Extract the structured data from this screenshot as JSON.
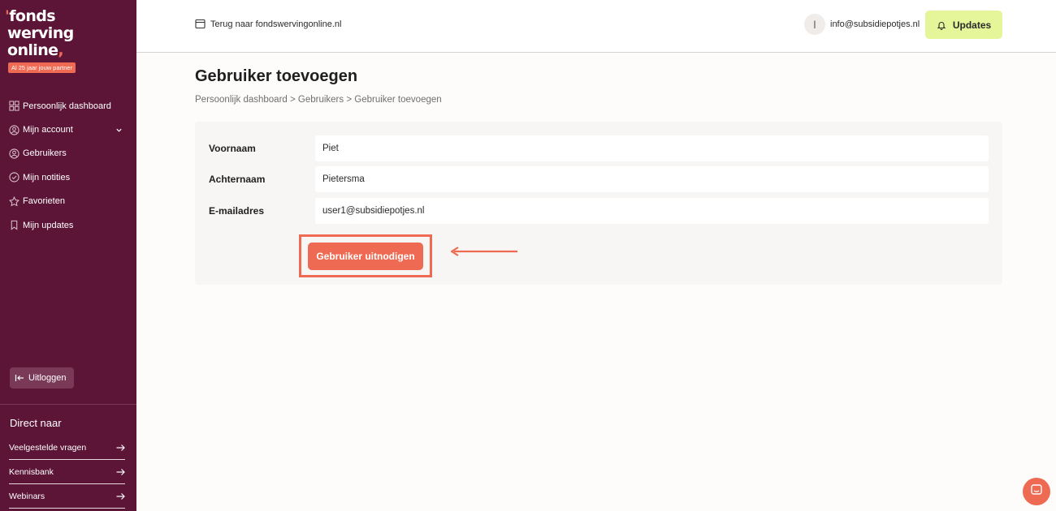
{
  "logo": {
    "line1": "fonds",
    "line2": "werving",
    "line3": "online",
    "badge": "Al 25 jaar jouw partner"
  },
  "sidebar": {
    "items": [
      {
        "label": "Persoonlijk dashboard",
        "icon": "dashboard-icon"
      },
      {
        "label": "Mijn account",
        "icon": "user-circle-icon",
        "has_dropdown": true
      },
      {
        "label": "Gebruikers",
        "icon": "users-icon"
      },
      {
        "label": "Mijn notities",
        "icon": "check-circle-icon"
      },
      {
        "label": "Favorieten",
        "icon": "star-icon"
      },
      {
        "label": "Mijn updates",
        "icon": "bookmark-icon"
      }
    ],
    "logout_label": "Uitloggen",
    "direct_title": "Direct naar",
    "direct_links": [
      {
        "label": "Veelgestelde vragen"
      },
      {
        "label": "Kennisbank"
      },
      {
        "label": "Webinars"
      }
    ]
  },
  "header": {
    "back_label": "Terug naar fondswervingonline.nl",
    "user_initial": "I",
    "user_email": "info@subsidiepotjes.nl",
    "updates_label": "Updates"
  },
  "main": {
    "title": "Gebruiker toevoegen",
    "breadcrumb": "Persoonlijk dashboard > Gebruikers > Gebruiker toevoegen",
    "form": {
      "fields": [
        {
          "label": "Voornaam",
          "value": "Piet"
        },
        {
          "label": "Achternaam",
          "value": "Pietersma"
        },
        {
          "label": "E-mailadres",
          "value": "user1@subsidiepotjes.nl"
        }
      ],
      "submit_label": "Gebruiker uitnodigen"
    }
  },
  "colors": {
    "sidebar_bg": "#5c1537",
    "accent": "#ef6a52",
    "updates_bg": "#e5f59a"
  }
}
